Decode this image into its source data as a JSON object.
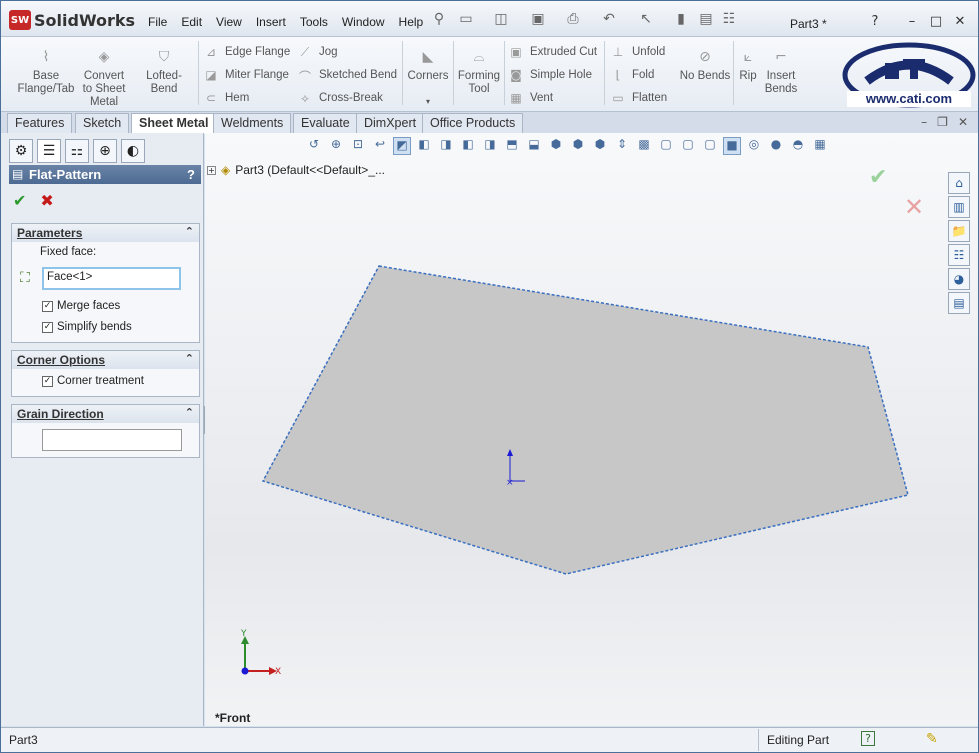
{
  "app": {
    "logo_text": "SolidWorks",
    "logo_badge": "SW",
    "doc_title": "Part3 *"
  },
  "menu": [
    "File",
    "Edit",
    "View",
    "Insert",
    "Tools",
    "Window",
    "Help"
  ],
  "ribbon": {
    "large": [
      {
        "label": "Base\nFlange/Tab",
        "icon": "base-flange-icon"
      },
      {
        "label": "Convert\nto Sheet\nMetal",
        "icon": "convert-sheet-metal-icon"
      },
      {
        "label": "Lofted-Bend",
        "icon": "lofted-bend-icon"
      },
      {
        "label": "Corners",
        "icon": "corners-icon"
      },
      {
        "label": "Forming\nTool",
        "icon": "forming-tool-icon"
      },
      {
        "label": "No Bends",
        "icon": "no-bends-icon"
      },
      {
        "label": "Rip",
        "icon": "rip-icon"
      },
      {
        "label": "Insert\nBends",
        "icon": "insert-bends-icon"
      }
    ],
    "col1": [
      "Edge Flange",
      "Miter Flange",
      "Hem"
    ],
    "col2": [
      "Jog",
      "Sketched Bend",
      "Cross-Break"
    ],
    "col3": [
      "Extruded Cut",
      "Simple Hole",
      "Vent"
    ],
    "col4": [
      "Unfold",
      "Fold",
      "Flatten"
    ],
    "brand": "www.cati.com"
  },
  "tabs": [
    "Features",
    "Sketch",
    "Sheet Metal",
    "Weldments",
    "Evaluate",
    "DimXpert",
    "Office Products"
  ],
  "active_tab": "Sheet Metal",
  "property_manager": {
    "title": "Flat-Pattern",
    "help": "?",
    "groups": {
      "parameters": {
        "title": "Parameters",
        "fixed_face_label": "Fixed face:",
        "fixed_face_value": "Face<1>",
        "merge_faces": "Merge faces",
        "simplify_bends": "Simplify bends"
      },
      "corner_options": {
        "title": "Corner Options",
        "corner_treatment": "Corner treatment"
      },
      "grain_direction": {
        "title": "Grain Direction",
        "value": ""
      }
    }
  },
  "tree": {
    "label": "Part3  (Default<<Default>_..."
  },
  "viewport": {
    "view_label": "*Front",
    "triad": {
      "x": "X",
      "y": "Y"
    },
    "part_color": "#c7c7c7",
    "edge_color": "#3a6fc0"
  },
  "status": {
    "left": "Part3",
    "mode": "Editing Part",
    "help": "?"
  }
}
